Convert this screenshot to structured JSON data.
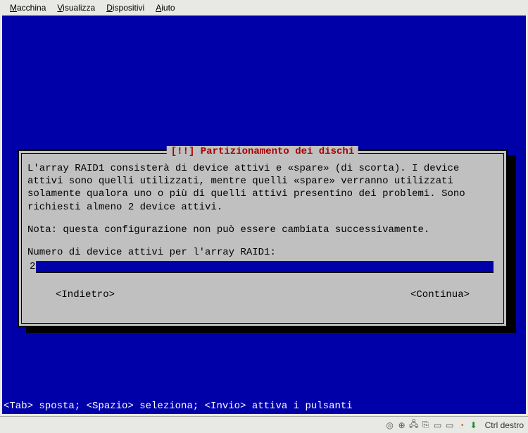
{
  "menubar": {
    "items": [
      {
        "accel": "M",
        "rest": "acchina"
      },
      {
        "accel": "V",
        "rest": "isualizza"
      },
      {
        "accel": "D",
        "rest": "ispositivi"
      },
      {
        "accel": "A",
        "rest": "iuto"
      }
    ]
  },
  "dialog": {
    "title": "[!!] Partizionamento dei dischi",
    "para1": "L'array RAID1 consisterà di device attivi e «spare» (di scorta). I device attivi sono quelli utilizzati, mentre quelli «spare» verranno utilizzati solamente qualora uno o più di quelli attivi presentino dei problemi. Sono richiesti almeno 2 device attivi.",
    "para2": "Nota: questa configurazione non può essere cambiata successivamente.",
    "prompt": "Numero di device attivi per l'array RAID1:",
    "input_value": "2",
    "back": "<Indietro>",
    "continue": "<Continua>"
  },
  "status": "<Tab> sposta; <Spazio> seleziona; <Invio> attiva i pulsanti",
  "bottombar": {
    "ctrl": "Ctrl destro"
  }
}
